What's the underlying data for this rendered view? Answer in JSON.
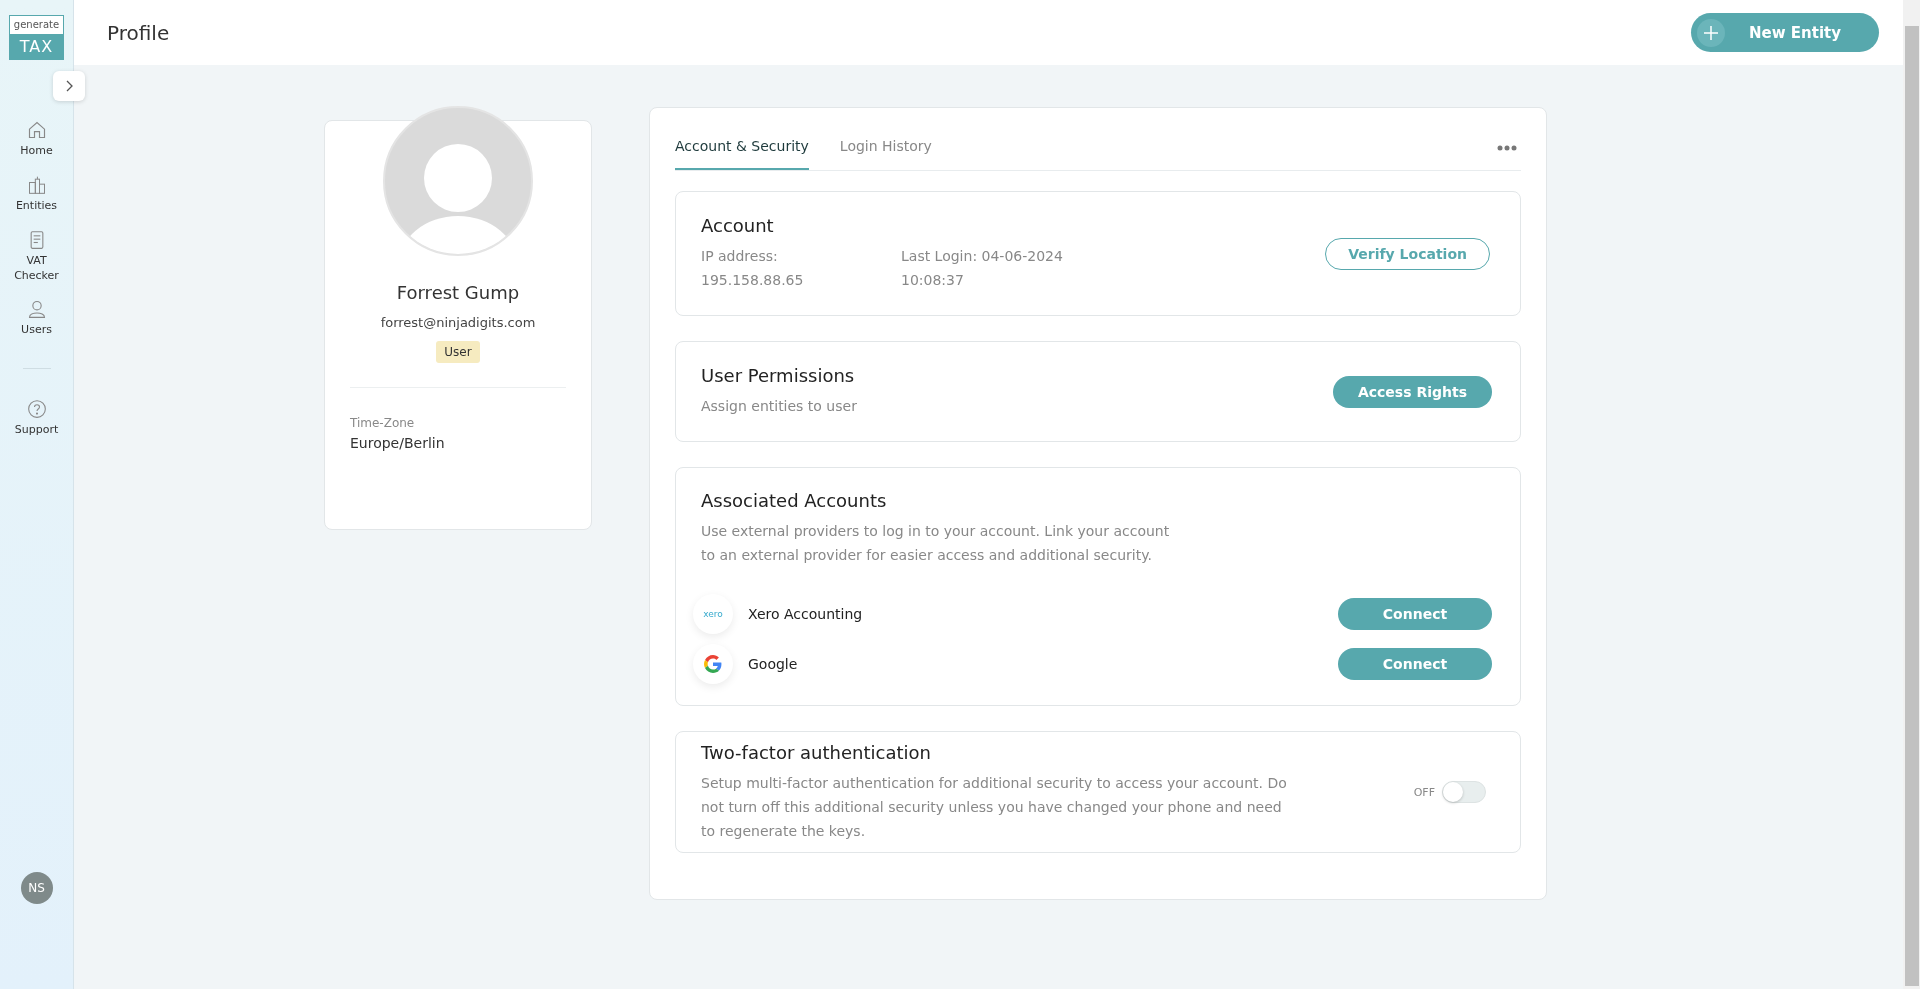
{
  "logo": {
    "top": "generate",
    "bottom": "TAX"
  },
  "sidebar": {
    "items": [
      {
        "kind": "home",
        "label": "Home"
      },
      {
        "kind": "entities",
        "label": "Entities"
      },
      {
        "kind": "document",
        "label": "VAT Checker"
      },
      {
        "kind": "user",
        "label": "Users"
      },
      {
        "kind": "divider"
      },
      {
        "kind": "help",
        "label": "Support"
      }
    ],
    "user_initials": "NS"
  },
  "header": {
    "title": "Profile",
    "new_button": "New Entity"
  },
  "profile": {
    "name": "Forrest Gump",
    "email": "forrest@ninjadigits.com",
    "role": "User",
    "timezone_label": "Time-Zone",
    "timezone": "Europe/Berlin"
  },
  "tabs": [
    {
      "label": "Account & Security",
      "selected": true
    },
    {
      "label": "Login History",
      "selected": false
    }
  ],
  "account": {
    "title": "Account",
    "ip_label": "IP address:",
    "ip": "195.158.88.65",
    "last_login_label": "Last Login: 04-06-2024",
    "last_login_time": "10:08:37",
    "button": "Verify Location"
  },
  "permissions": {
    "title": "User Permissions",
    "subtitle": "Assign entities to user",
    "button": "Access Rights"
  },
  "associated": {
    "title": "Associated Accounts",
    "description": "Use external providers to log in to your account. Link your account to an external provider for easier access and additional security.",
    "providers": [
      {
        "kind": "xero",
        "logo_text": "xero",
        "name": "Xero Accounting",
        "button": "Connect"
      },
      {
        "kind": "google",
        "name": "Google",
        "button": "Connect"
      }
    ]
  },
  "two_factor": {
    "title": "Two-factor authentication",
    "description": "Setup multi-factor authentication for additional security to access your account. Do not turn off this additional security unless you have changed your phone and need to regenerate the keys.",
    "state_label": "OFF",
    "on": false
  }
}
